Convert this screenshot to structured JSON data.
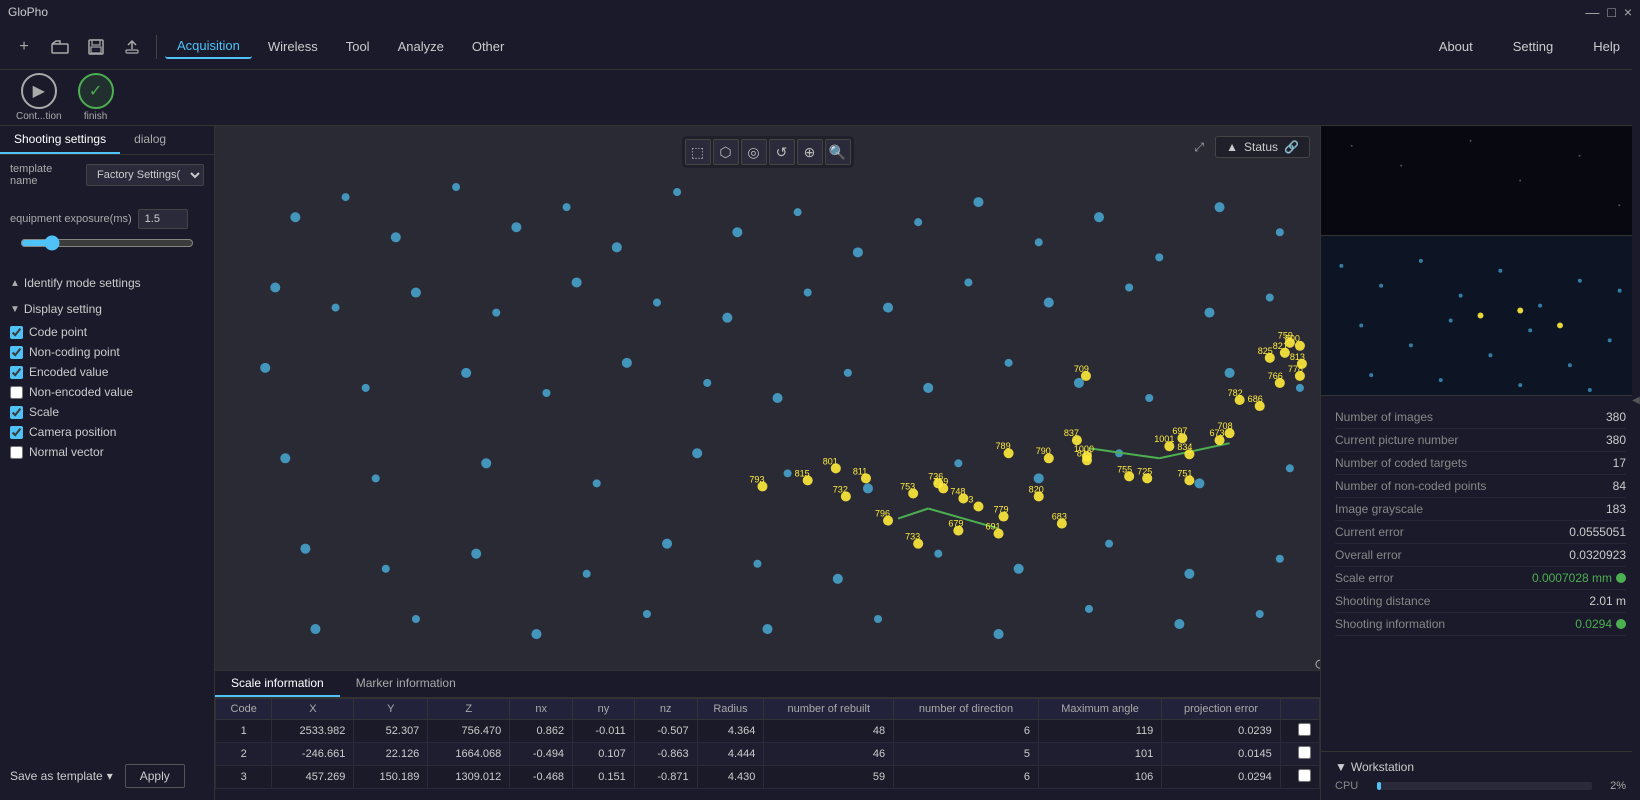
{
  "app": {
    "title": "GloPho",
    "titlebar_controls": [
      "—",
      "□",
      "×"
    ]
  },
  "menubar": {
    "icon_buttons": [
      "+",
      "📁",
      "📋",
      "↗"
    ],
    "items": [
      {
        "label": "Acquisition",
        "active": true
      },
      {
        "label": "Wireless",
        "active": false
      },
      {
        "label": "Tool",
        "active": false
      },
      {
        "label": "Analyze",
        "active": false
      },
      {
        "label": "Other",
        "active": false
      }
    ],
    "right_items": [
      "About",
      "Setting",
      "Help"
    ]
  },
  "left_panel": {
    "tabs": [
      {
        "label": "Shooting settings",
        "active": true
      },
      {
        "label": "dialog",
        "active": false
      }
    ],
    "template_name_label": "template name",
    "template_name_value": "Factory Settings(",
    "exposure_label": "equipment exposure(ms)",
    "exposure_value": "1.5",
    "identify_section": "Identify mode settings",
    "display_section": "Display setting",
    "checkboxes": [
      {
        "label": "Code point",
        "checked": true
      },
      {
        "label": "Non-coding point",
        "checked": true
      },
      {
        "label": "Encoded value",
        "checked": true
      },
      {
        "label": "Non-encoded value",
        "checked": false
      },
      {
        "label": "Scale",
        "checked": true
      },
      {
        "label": "Camera position",
        "checked": true
      },
      {
        "label": "Normal vector",
        "checked": false
      }
    ],
    "save_template_label": "Save as template",
    "apply_label": "Apply"
  },
  "canvas": {
    "toolbar_icons": [
      "⬚",
      "⬡",
      "◎",
      "↺",
      "⊕",
      "🔍"
    ],
    "status_label": "Status"
  },
  "data_table": {
    "tabs": [
      "Scale information",
      "Marker information"
    ],
    "active_tab": "Scale information",
    "columns": [
      "Code",
      "X",
      "Y",
      "Z",
      "nx",
      "ny",
      "nz",
      "Radius",
      "number of rebuilt",
      "number of direction",
      "Maximum angle",
      "projection error"
    ],
    "rows": [
      {
        "code": "1",
        "x": "2533.982",
        "y": "52.307",
        "z": "756.470",
        "nx": "0.862",
        "ny": "-0.011",
        "nz": "-0.507",
        "radius": "4.364",
        "rebuilt": "48",
        "direction": "6",
        "max_angle": "119",
        "proj_err": "0.0239",
        "check": "□"
      },
      {
        "code": "2",
        "x": "-246.661",
        "y": "22.126",
        "z": "1664.068",
        "nx": "-0.494",
        "ny": "0.107",
        "nz": "-0.863",
        "radius": "4.444",
        "rebuilt": "46",
        "direction": "5",
        "max_angle": "101",
        "proj_err": "0.0145",
        "check": "□"
      },
      {
        "code": "3",
        "x": "457.269",
        "y": "150.189",
        "z": "1309.012",
        "nx": "-0.468",
        "ny": "0.151",
        "nz": "-0.871",
        "radius": "4.430",
        "rebuilt": "59",
        "direction": "6",
        "max_angle": "106",
        "proj_err": "0.0294",
        "check": "□"
      }
    ]
  },
  "right_panel": {
    "stats": [
      {
        "label": "Number of images",
        "value": "380"
      },
      {
        "label": "Current picture number",
        "value": "380"
      },
      {
        "label": "Number of coded targets",
        "value": "17"
      },
      {
        "label": "Number of non-coded points",
        "value": "84"
      },
      {
        "label": "Image grayscale",
        "value": "183"
      },
      {
        "label": "Current error",
        "value": "0.0555051"
      },
      {
        "label": "Overall error",
        "value": "0.0320923"
      },
      {
        "label": "Scale error",
        "value": "0.0007028 mm",
        "green": true
      },
      {
        "label": "Shooting distance",
        "value": "2.01 m"
      },
      {
        "label": "Shooting information",
        "value": "0.0294",
        "green": true
      }
    ],
    "workstation_label": "Workstation",
    "cpu_label": "CPU",
    "cpu_pct": "2%",
    "cpu_bar_width": 2
  }
}
